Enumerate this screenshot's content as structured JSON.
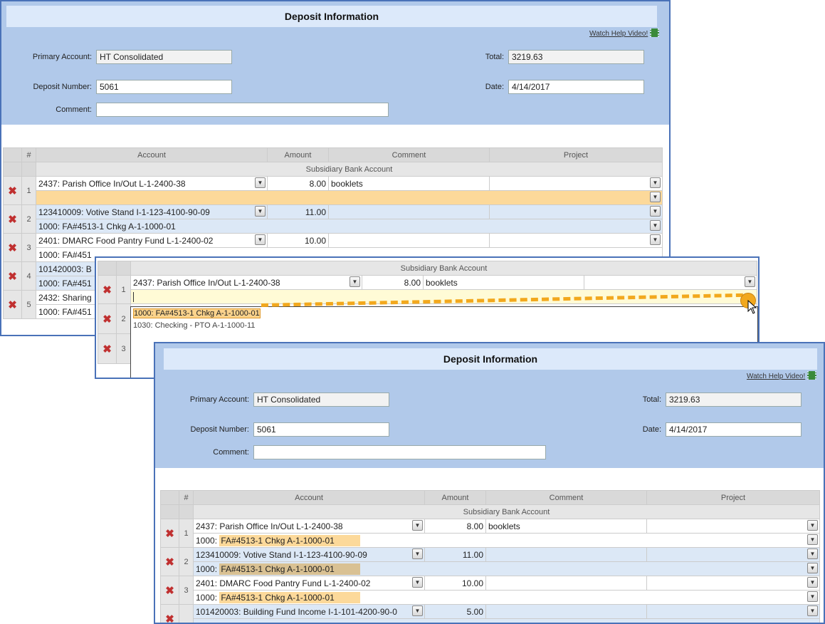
{
  "header": {
    "title": "Deposit Information",
    "help_link": "Watch Help Video!",
    "primary_account_label": "Primary Account:",
    "primary_account": "HT Consolidated",
    "deposit_number_label": "Deposit Number:",
    "deposit_number": "5061",
    "comment_label": "Comment:",
    "comment": "",
    "total_label": "Total:",
    "total": "3219.63",
    "date_label": "Date:",
    "date": "4/14/2017"
  },
  "grid": {
    "columns": [
      "#",
      "Account",
      "Amount",
      "Comment",
      "Project"
    ],
    "subheader": "Subsidiary Bank Account",
    "delete_glyph": "✖",
    "dropdown_glyph": "▼"
  },
  "panel1": {
    "rows": [
      {
        "num": "1",
        "account": "2437: Parish Office In/Out L-1-2400-38",
        "amount": "8.00",
        "comment": "booklets",
        "sub": ""
      },
      {
        "num": "2",
        "account": "123410009: Votive Stand I-1-123-4100-90-09",
        "amount": "11.00",
        "comment": "",
        "sub": "1000: FA#4513-1 Chkg A-1-1000-01"
      },
      {
        "num": "3",
        "account": "2401: DMARC Food Pantry Fund L-1-2400-02",
        "amount": "10.00",
        "comment": "",
        "sub": "1000: FA#451"
      },
      {
        "num": "4",
        "account": "101420003: B",
        "sub": "1000: FA#451"
      },
      {
        "num": "5",
        "account": "2432: Sharing",
        "sub": "1000: FA#451"
      }
    ]
  },
  "panel2": {
    "row": {
      "num": "1",
      "account": "2437: Parish Office In/Out L-1-2400-38",
      "amount": "8.00",
      "comment": "booklets"
    },
    "row_nums": [
      "2",
      "3"
    ],
    "options": [
      "1000: FA#4513-1 Chkg A-1-1000-01",
      "1030: Checking - PTO A-1-1000-11"
    ]
  },
  "panel3": {
    "sub_prefix": "1000: ",
    "sub_value": "FA#4513-1 Chkg A-1-1000-01",
    "rows": [
      {
        "num": "1",
        "account": "2437: Parish Office In/Out L-1-2400-38",
        "amount": "8.00",
        "comment": "booklets"
      },
      {
        "num": "2",
        "account": "123410009: Votive Stand I-1-123-4100-90-09",
        "amount": "11.00",
        "comment": ""
      },
      {
        "num": "3",
        "account": "2401: DMARC Food Pantry Fund L-1-2400-02",
        "amount": "10.00",
        "comment": ""
      },
      {
        "num": "4",
        "account": "101420003: Building Fund Income I-1-101-4200-90-0",
        "amount": "5.00",
        "comment": ""
      }
    ]
  },
  "colors": {
    "accent": "#4a72b8",
    "header_bg": "#b1c9ea",
    "highlight": "#fcd99a",
    "connector": "#f2a81d",
    "delete": "#c03030"
  }
}
